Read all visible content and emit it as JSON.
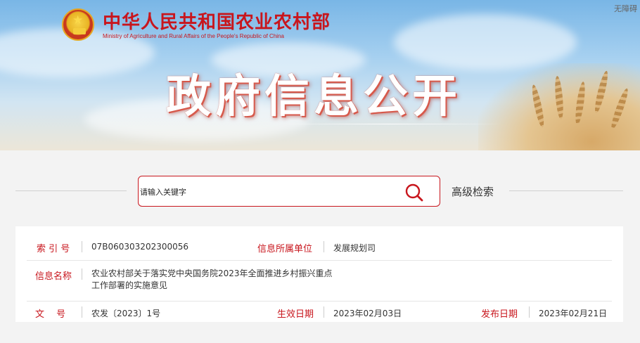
{
  "header": {
    "site_title": "中华人民共和国农业农村部",
    "site_subtitle": "Ministry of Agriculture and Rural Affairs of the People's Republic of China",
    "accessibility_label": "无障碍",
    "hero_title": "政府信息公开"
  },
  "search": {
    "placeholder": "请输入关键字",
    "advanced_label": "高级检索"
  },
  "info": {
    "index_label": "索 引 号",
    "index_value": "07B060303202300056",
    "unit_label": "信息所属单位",
    "unit_value": "发展规划司",
    "name_label": "信息名称",
    "name_line1": "农业农村部关于落实党中央国务院2023年全面推进乡村振兴重点",
    "name_line2": "工作部署的实施意见",
    "docno_label": "文　 号",
    "docno_value": "农发〔2023〕1号",
    "effective_label": "生效日期",
    "effective_value": "2023年02月03日",
    "publish_label": "发布日期",
    "publish_value": "2023年02月21日"
  },
  "colors": {
    "brand_red": "#c8161d",
    "sky_blue": "#79b6e6"
  }
}
